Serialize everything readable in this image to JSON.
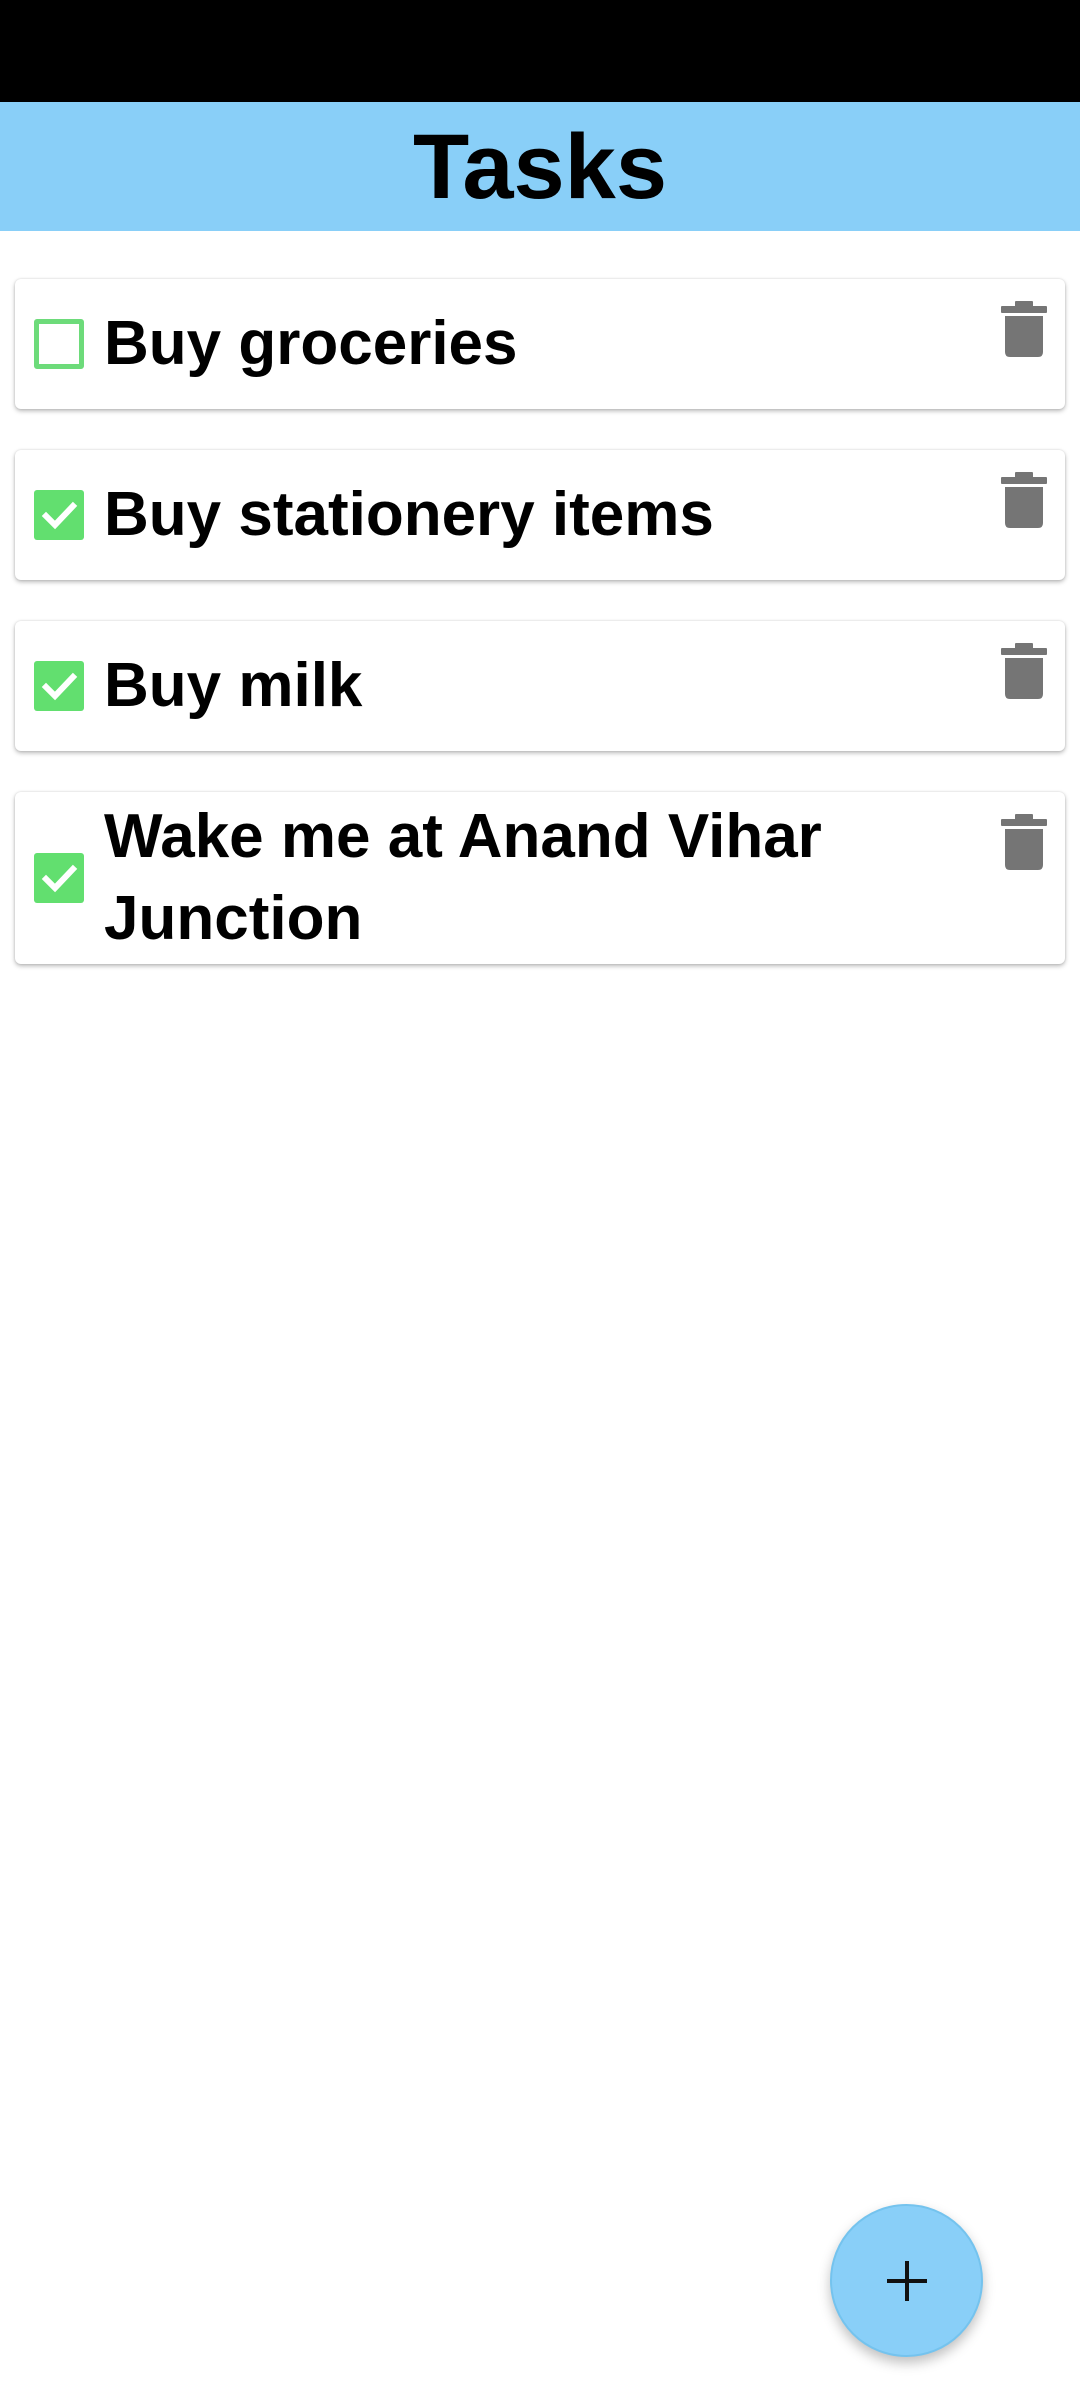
{
  "app": {
    "title": "Tasks"
  },
  "colors": {
    "app_bar": "#89cff8",
    "checkbox": "#62df6f",
    "delete_icon": "#757575",
    "fab": "#89cff8"
  },
  "tasks": [
    {
      "label": "Buy groceries",
      "checked": false,
      "icon": "checkbox-unchecked-icon",
      "delete_icon": "trash-icon"
    },
    {
      "label": "Buy stationery items",
      "checked": true,
      "icon": "checkbox-checked-icon",
      "delete_icon": "trash-icon"
    },
    {
      "label": "Buy milk",
      "checked": true,
      "icon": "checkbox-checked-icon",
      "delete_icon": "trash-icon"
    },
    {
      "label": "Wake me at Anand Vihar Junction",
      "checked": true,
      "icon": "checkbox-checked-icon",
      "delete_icon": "trash-icon"
    }
  ],
  "fab": {
    "icon": "plus-icon"
  }
}
